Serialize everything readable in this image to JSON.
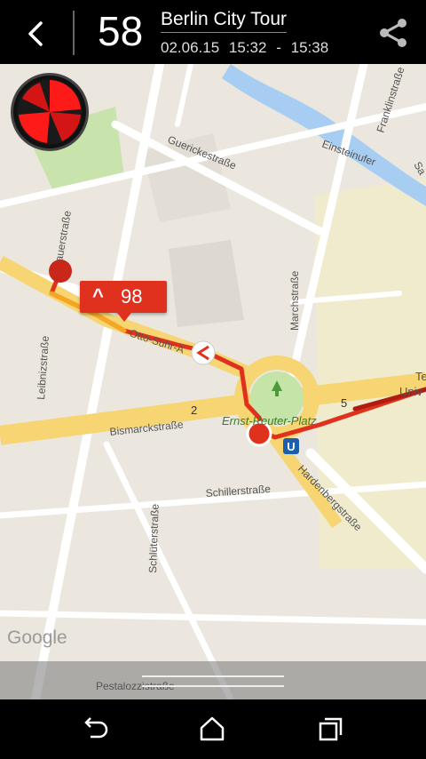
{
  "header": {
    "count": "58",
    "title": "Berlin City Tour",
    "date": "02.06.15",
    "start": "15:32",
    "separator": "-",
    "end": "15:38"
  },
  "map": {
    "streets": [
      "Guerickestraße",
      "Einsteinufer",
      "Franklinstraße",
      "Marchstraße",
      "Leibnizstraße",
      "Bismarckstraße",
      "Otto-Suhr-A",
      "Schillerstraße",
      "Schlüterstraße",
      "Hardenbergstraße",
      "Ernst-Reuter-Platz",
      "Pestalozzistraße",
      "Sa",
      "Te",
      "Univ",
      "auerstraße"
    ],
    "route_markers": [
      "2",
      "5"
    ],
    "transit_label": "U",
    "google_logo": "Google"
  },
  "speed_badge": {
    "value": "98"
  },
  "colors": {
    "route_red": "#e0301e",
    "route_dark": "#b01d10",
    "road_yellow": "#f6d572",
    "water": "#a7cdf2",
    "park": "#c5e4a8"
  }
}
